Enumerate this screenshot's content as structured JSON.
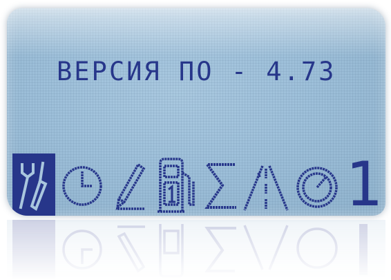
{
  "screen": {
    "version_line": "ВЕРСИЯ ПО - 4.73",
    "menu_number": "1",
    "colors": {
      "lcd_background": "#9dbfd9",
      "pixel_ink": "#27368a",
      "selected_tile": "#27368a"
    }
  },
  "menu_icons": [
    {
      "name": "wrench-screwdriver-icon",
      "selected": true
    },
    {
      "name": "clock-icon",
      "selected": false
    },
    {
      "name": "pencil-icon",
      "selected": false
    },
    {
      "name": "fuel-pump-icon",
      "selected": false
    },
    {
      "name": "sigma-icon",
      "selected": false
    },
    {
      "name": "road-icon",
      "selected": false
    },
    {
      "name": "speedometer-icon",
      "selected": false
    }
  ]
}
